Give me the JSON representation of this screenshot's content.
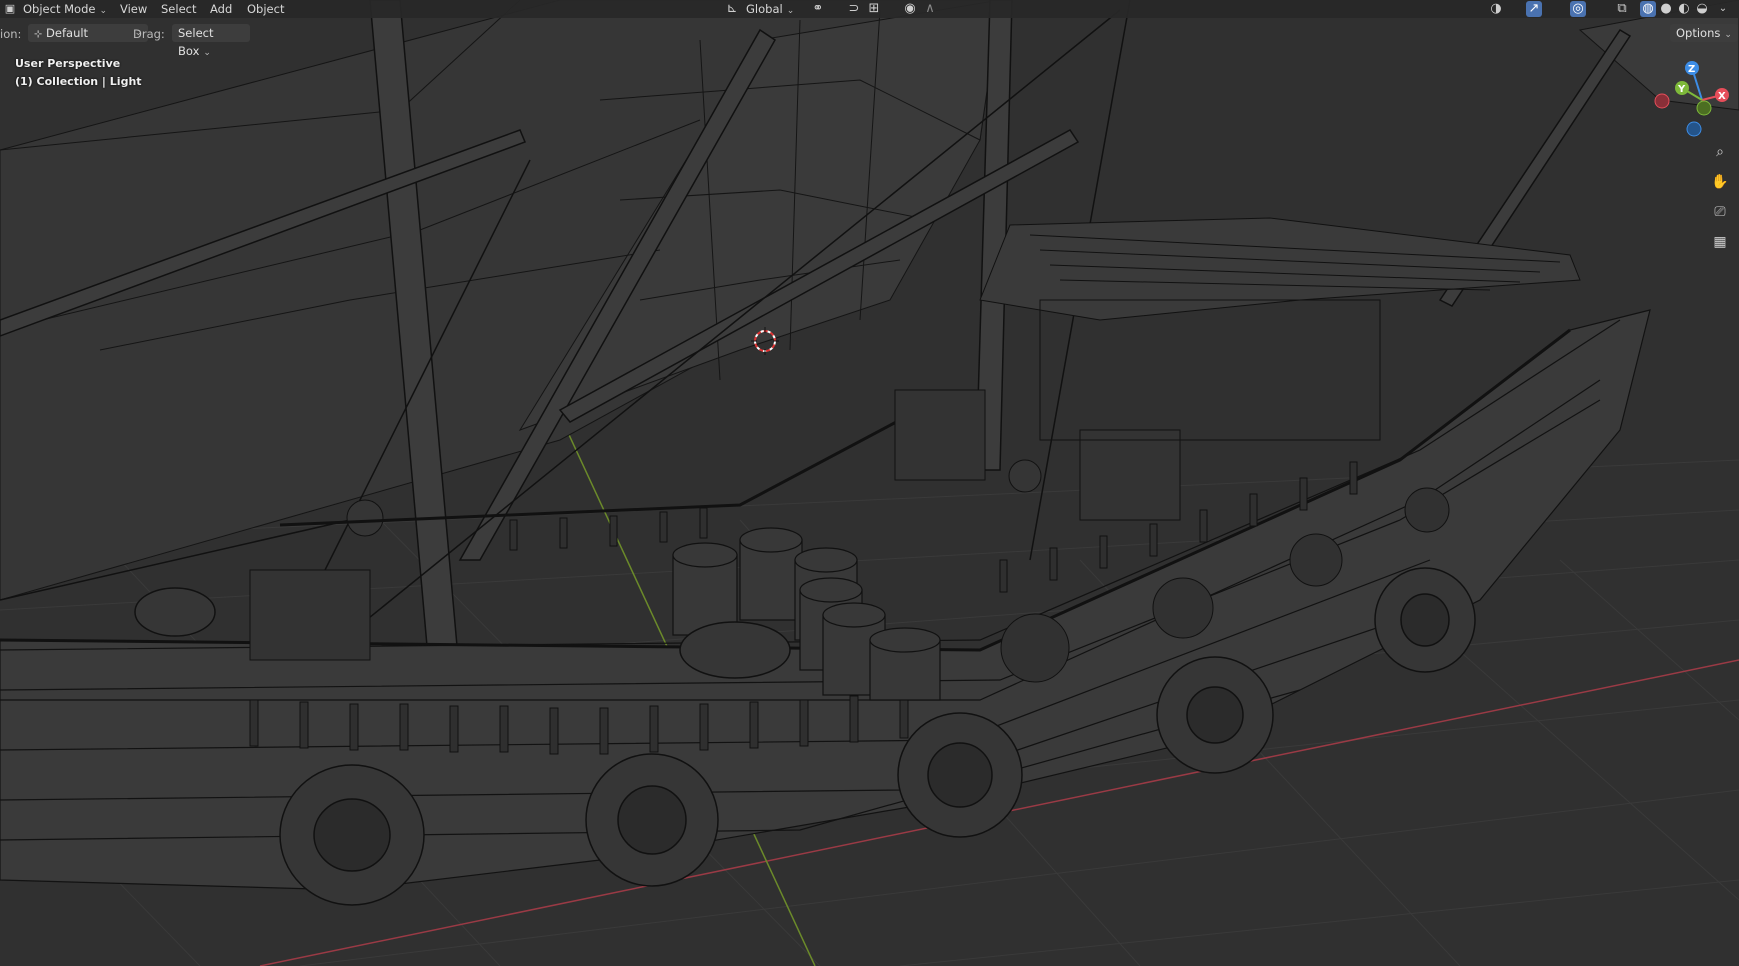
{
  "header": {
    "mode": "Object Mode",
    "menu": [
      "View",
      "Select",
      "Add",
      "Object"
    ],
    "transform_orientation": "Global",
    "options_label": "Options"
  },
  "tool_settings": {
    "orientation_prefix": "ion:",
    "orientation_value": "Default",
    "drag_label": "Drag:",
    "drag_value": "Select Box"
  },
  "viewport": {
    "perspective": "User Perspective",
    "collection": "(1) Collection | Light"
  },
  "gizmo": {
    "x_label": "X",
    "y_label": "Y",
    "z_label": "Z"
  },
  "icons": {
    "editor_type": "editor-type-icon",
    "orientation": "transform-orientation-icon",
    "pivot": "pivot-point-icon",
    "snap": "snap-icon",
    "snap_target": "snap-increment-icon",
    "proportional": "proportional-edit-icon",
    "visibility": "visibility-icon",
    "gizmo_toggle": "gizmo-toggle-icon",
    "overlay_toggle": "overlay-toggle-icon",
    "xray": "xray-icon",
    "shading_wire": "wireframe-shading-icon",
    "shading_solid": "solid-shading-icon",
    "shading_material": "material-shading-icon",
    "shading_rendered": "rendered-shading-icon",
    "zoom": "zoom-icon",
    "pan": "hand-pan-icon",
    "camera": "camera-icon",
    "ortho": "grid-ortho-icon"
  },
  "colors": {
    "background": "#303030",
    "grid": "#3b3b3b",
    "axis_x": "#9a3a45",
    "axis_y": "#6b8a2a",
    "wire": "#0f0f0f",
    "gizmo_x": "#e64e5a",
    "gizmo_y": "#7eb93a",
    "gizmo_z": "#3d8de6",
    "active_button": "#4a72b0"
  }
}
